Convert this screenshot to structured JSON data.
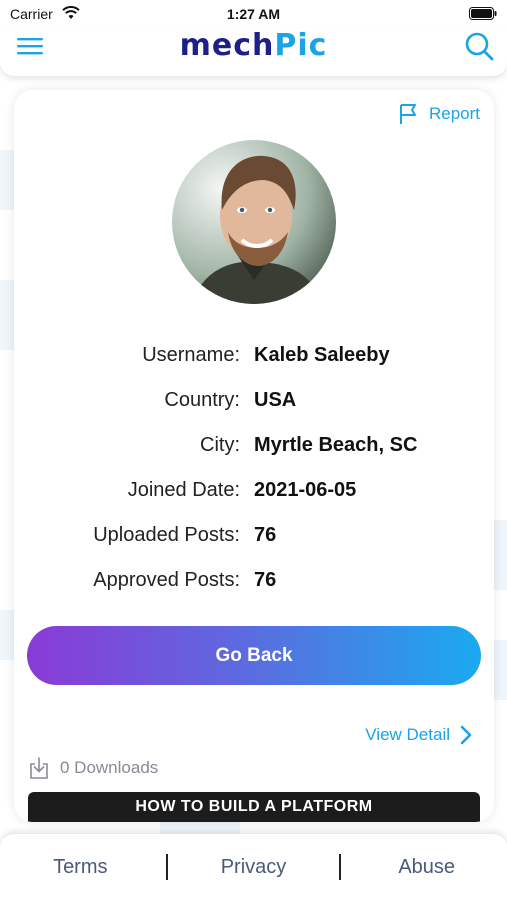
{
  "status_bar": {
    "carrier": "Carrier",
    "time": "1:27 AM"
  },
  "header": {
    "logo_part1": "mech",
    "logo_part2": "Pic",
    "brand_colors": {
      "primary": "#1f1f8a",
      "accent": "#1aa3e6"
    },
    "menu_icon": "hamburger-menu-icon",
    "search_icon": "search-icon"
  },
  "profile": {
    "report_label": "Report",
    "report_icon": "flag-icon",
    "fields": [
      {
        "label": "Username:",
        "value": "Kaleb Saleeby"
      },
      {
        "label": "Country:",
        "value": "USA"
      },
      {
        "label": "City:",
        "value": "Myrtle Beach, SC"
      },
      {
        "label": "Joined Date:",
        "value": "2021-06-05"
      },
      {
        "label": "Uploaded Posts:",
        "value": "76"
      },
      {
        "label": "Approved Posts:",
        "value": "76"
      }
    ],
    "go_back_label": "Go Back",
    "go_back_gradient": [
      "#8a3ad6",
      "#1aaaf0"
    ]
  },
  "post": {
    "view_detail_label": "View Detail",
    "downloads_label": "0 Downloads",
    "title_banner": "HOW TO BUILD A PLATFORM"
  },
  "footer": {
    "links": [
      "Terms",
      "Privacy",
      "Abuse"
    ]
  }
}
